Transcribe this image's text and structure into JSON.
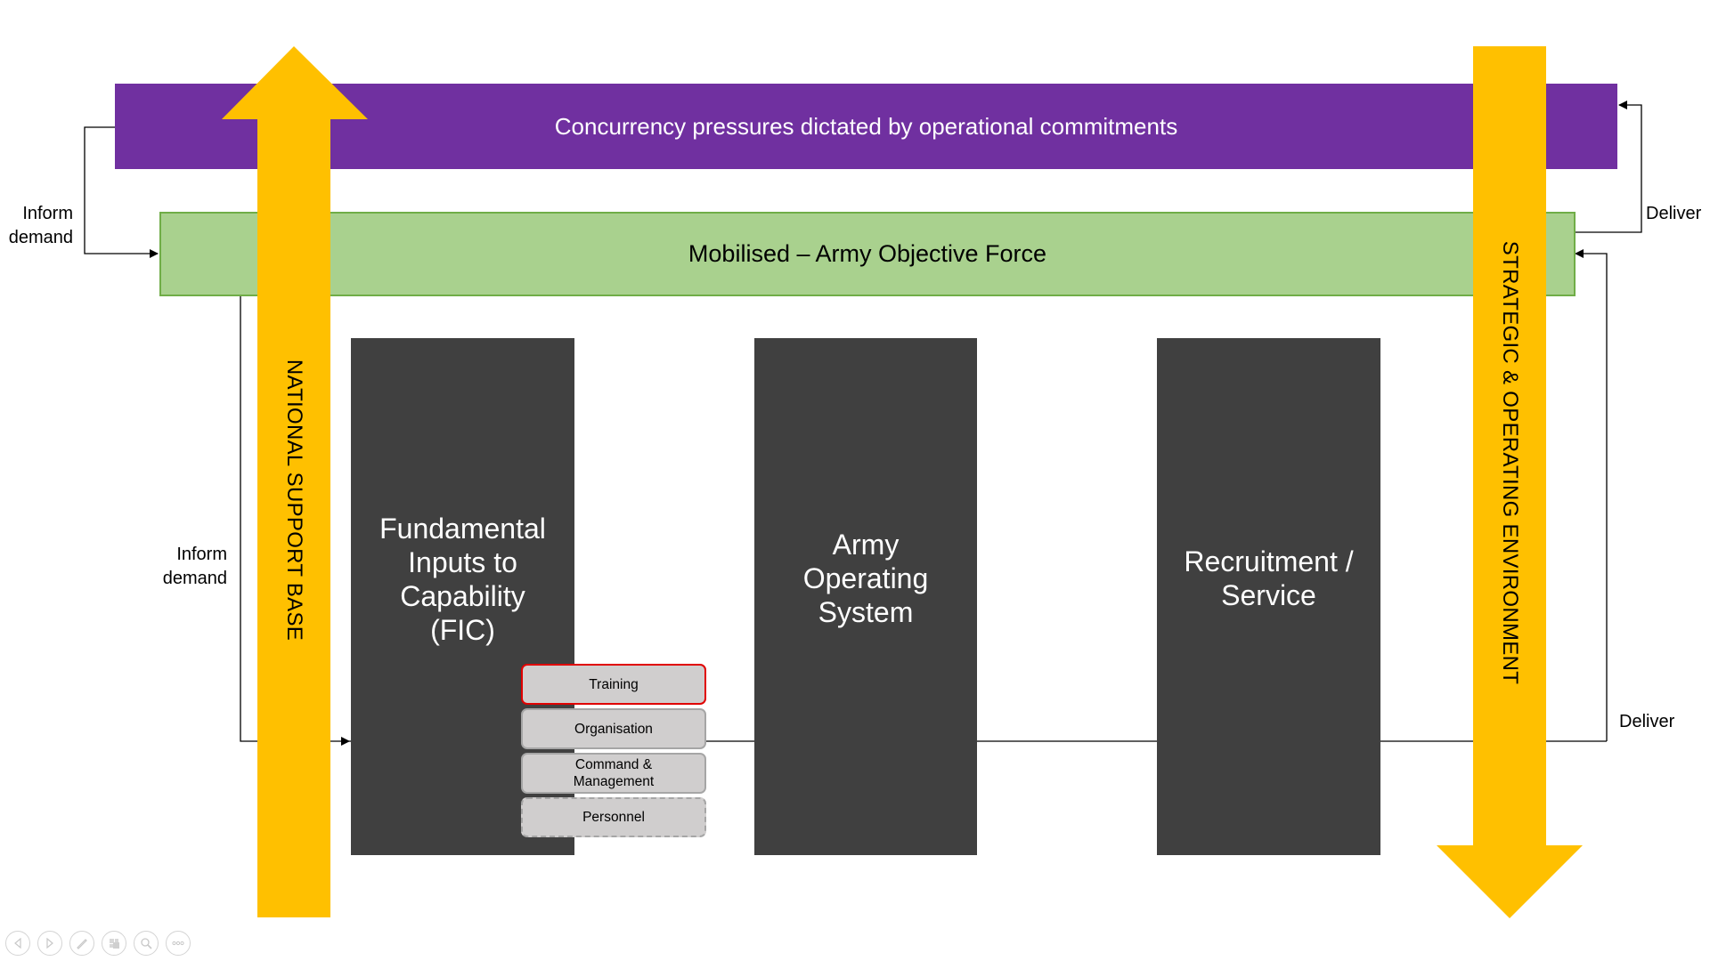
{
  "diagram": {
    "top_bar": {
      "label": "Concurrency pressures dictated by operational commitments",
      "color": "#7030a0"
    },
    "objective_force": {
      "label": "Mobilised – Army Objective Force",
      "color": "#a9d18e",
      "border_color": "#70ad47"
    },
    "left_arrow": {
      "label": "NATIONAL SUPPORT BASE",
      "direction": "up",
      "color": "#ffc000"
    },
    "right_arrow": {
      "label": "STRATEGIC & OPERATING ENVIRONMENT",
      "direction": "down",
      "color": "#ffc000"
    },
    "pillars": [
      {
        "lines": [
          "Fundamental",
          "Inputs to",
          "Capability",
          "(FIC)"
        ]
      },
      {
        "lines": [
          "Army",
          "Operating",
          "System"
        ]
      },
      {
        "lines": [
          "Recruitment /",
          "Service"
        ]
      }
    ],
    "fic_items": [
      {
        "label": "Training",
        "highlight": "red-border"
      },
      {
        "label": "Organisation",
        "highlight": "none"
      },
      {
        "label": "Command & Management",
        "lines": [
          "Command &",
          "Management"
        ],
        "highlight": "none"
      },
      {
        "label": "Personnel",
        "highlight": "dashed-border"
      }
    ],
    "connectors": {
      "inform_demand_top": {
        "lines": [
          "Inform",
          "demand"
        ]
      },
      "inform_demand_lower": {
        "lines": [
          "Inform",
          "demand"
        ]
      },
      "deliver_top": {
        "label": "Deliver"
      },
      "deliver_lower": {
        "label": "Deliver"
      }
    }
  },
  "presentation_toolbar": {
    "buttons": [
      {
        "name": "previous-slide",
        "icon": "triangle-left"
      },
      {
        "name": "next-slide",
        "icon": "triangle-right"
      },
      {
        "name": "pen",
        "icon": "pen"
      },
      {
        "name": "slides-view",
        "icon": "grid"
      },
      {
        "name": "zoom",
        "icon": "magnifier"
      },
      {
        "name": "more-options",
        "icon": "ellipsis"
      }
    ]
  }
}
